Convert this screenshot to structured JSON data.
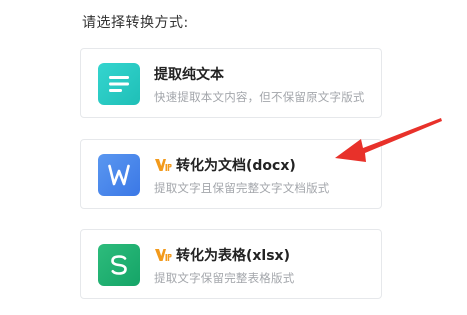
{
  "prompt": "请选择转换方式:",
  "options": [
    {
      "title": "提取纯文本",
      "description": "快速提取本文内容，但不保留原文字版式",
      "icon": "text-lines-icon",
      "vip": false,
      "color": "#26c8c0"
    },
    {
      "title": "转化为文档(docx)",
      "description": "提取文字且保留完整文字文档版式",
      "icon": "word-doc-icon",
      "vip": true,
      "color": "#4a87ec"
    },
    {
      "title": "转化为表格(xlsx)",
      "description": "提取文字保留完整表格版式",
      "icon": "spreadsheet-icon",
      "vip": true,
      "color": "#1faf70"
    }
  ],
  "annotation": {
    "type": "arrow",
    "color": "#e8312a"
  },
  "vip_badge_color": "#f29a1c"
}
